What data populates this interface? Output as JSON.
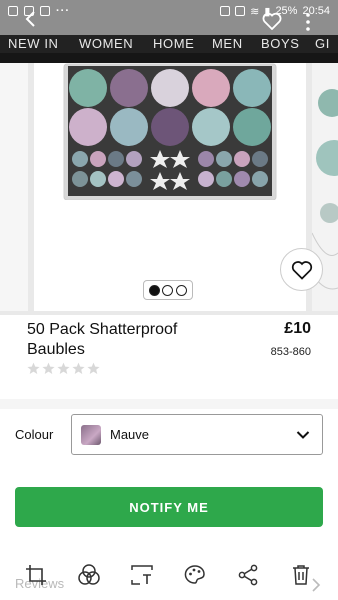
{
  "status_bar": {
    "battery": "25%",
    "time": "20:54"
  },
  "nav": {
    "items": [
      "NEW IN",
      "WOMEN",
      "HOME",
      "MEN",
      "BOYS",
      "GI"
    ]
  },
  "gallery": {
    "pages": 3,
    "active_page": 1
  },
  "product": {
    "title": "50 Pack Shatterproof Baubles",
    "price": "£10",
    "code": "853-860",
    "rating": 0,
    "max_rating": 5
  },
  "colour": {
    "label": "Colour",
    "value": "Mauve"
  },
  "actions": {
    "notify_label": "NOTIFY ME"
  },
  "footer": {
    "reviews_label": "Reviews"
  },
  "colors": {
    "accent": "#2ea84b",
    "nav_bg": "#222222",
    "header_bg": "#8e8e8e"
  },
  "toolbar_icons": [
    "crop-rotate-icon",
    "overlap-circles-icon",
    "text-select-icon",
    "palette-icon",
    "share-icon",
    "trash-icon"
  ]
}
